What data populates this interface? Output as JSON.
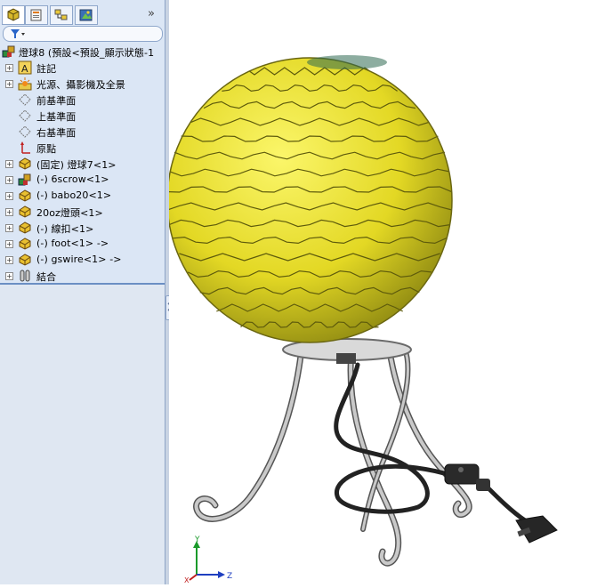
{
  "feature_manager": {
    "tabs": [
      {
        "name": "feature-tree-tab",
        "active": true
      },
      {
        "name": "property-tab",
        "active": false
      },
      {
        "name": "configuration-tab",
        "active": false
      },
      {
        "name": "display-tab",
        "active": false
      }
    ],
    "tabs_more_label": "»",
    "filter_icon": "filter-icon",
    "tree": [
      {
        "label": "燈球8 (預設<預設_顯示狀態-1",
        "icon": "assembly-icon",
        "expander": ""
      },
      {
        "label": "註記",
        "icon": "annotation-icon",
        "expander": "+"
      },
      {
        "label": "光源、攝影機及全景",
        "icon": "lights-icon",
        "expander": "+"
      },
      {
        "label": "前基準面",
        "icon": "plane-icon",
        "expander": ""
      },
      {
        "label": "上基準面",
        "icon": "plane-icon",
        "expander": ""
      },
      {
        "label": "右基準面",
        "icon": "plane-icon",
        "expander": ""
      },
      {
        "label": "原點",
        "icon": "origin-icon",
        "expander": ""
      },
      {
        "label": "(固定) 燈球7<1>",
        "icon": "part-icon",
        "expander": "+"
      },
      {
        "label": "(-) 6scrow<1>",
        "icon": "subassembly-icon",
        "expander": "+"
      },
      {
        "label": "(-) babo20<1>",
        "icon": "part-icon",
        "expander": "+"
      },
      {
        "label": "20oz燈頭<1>",
        "icon": "part-icon",
        "expander": "+"
      },
      {
        "label": "(-) 線扣<1>",
        "icon": "part-icon",
        "expander": "+"
      },
      {
        "label": "(-) foot<1> ->",
        "icon": "part-icon",
        "expander": "+"
      },
      {
        "label": "(-) gswire<1> ->",
        "icon": "part-icon",
        "expander": "+"
      },
      {
        "label": "結合",
        "icon": "mates-icon",
        "expander": "+"
      }
    ]
  },
  "viewport": {
    "model": "lamp-model",
    "triad_labels": {
      "x": "X",
      "y": "Y",
      "z": "Z"
    },
    "colors": {
      "shade": "#e8e02a",
      "shade_dark": "#8c8a12",
      "metal": "#b9b9b9",
      "cord": "#2a2a2a"
    }
  }
}
